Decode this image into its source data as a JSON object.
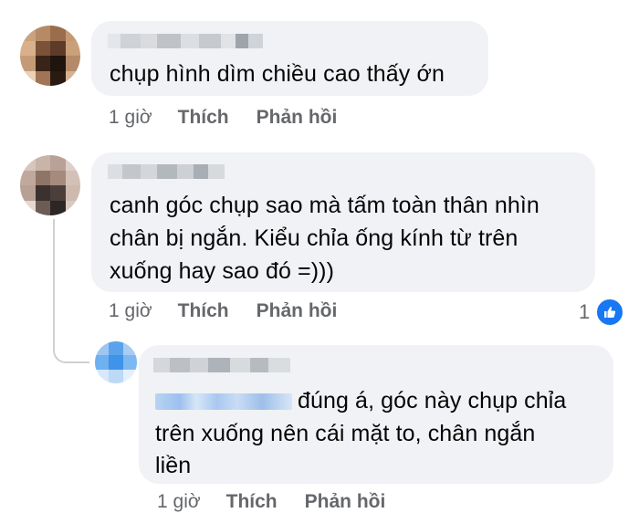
{
  "comments": [
    {
      "text": "chụp hình dìm chiều cao thấy ớn",
      "time": "1 giờ",
      "like_label": "Thích",
      "reply_label": "Phản hồi"
    },
    {
      "lines": [
        "canh góc chụp sao mà tấm toàn thân nhìn",
        "chân bị ngắn. Kiểu chỉa ống kính từ trên",
        "xuống hay sao đó =)))"
      ],
      "time": "1 giờ",
      "like_label": "Thích",
      "reply_label": "Phản hồi",
      "reaction_count": "1",
      "reaction_icon": "like-icon"
    }
  ],
  "reply": {
    "line1": "đúng á, góc này chụp chỉa",
    "line2": "trên xuống nên cái mặt to, chân ngắn",
    "line3": "liền",
    "time": "1 giờ",
    "like_label": "Thích",
    "reply_label": "Phản hồi"
  },
  "colors": {
    "bubble": "#f0f2f5",
    "meta_text": "#65676b",
    "like_blue": "#1877f2"
  }
}
